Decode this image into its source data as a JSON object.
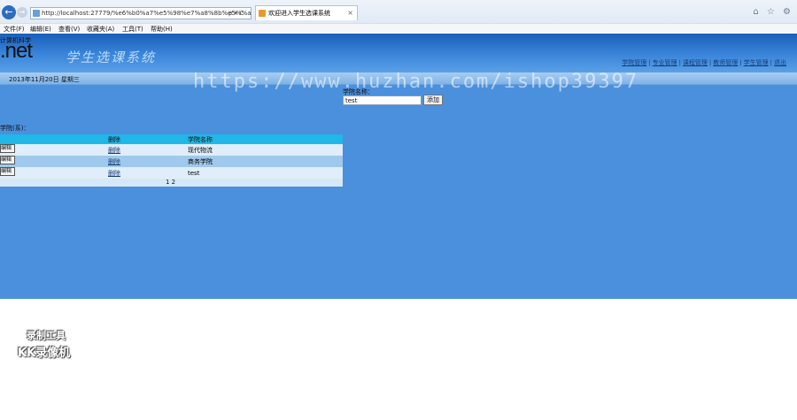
{
  "browser": {
    "address": "http://localhost:27779/%e6%b0%a7%e5%98%e7%a8%8b%e5%%a%8f",
    "address_tools": "ρ ▾ C",
    "tab_title": "欢迎进入学生选课系统",
    "tab_close": "×",
    "window_icons": "⌂ ☆ ⚙",
    "back_glyph": "←",
    "forward_glyph": "→",
    "menu": [
      "文件(F)",
      "编辑(E)",
      "查看(V)",
      "收藏夹(A)",
      "工具(T)",
      "帮助(H)"
    ]
  },
  "header": {
    "brand_small": "计算机科学",
    "brand": ".net",
    "system_title": "学生选课系统",
    "nav": [
      "学院管理",
      "专业管理",
      "课程管理",
      "教师管理",
      "学生管理",
      "退出"
    ]
  },
  "datebar": {
    "date": "2013年11月20日 星期三"
  },
  "add_form": {
    "label": "学院名称：",
    "value": "test",
    "button": "添加"
  },
  "section": {
    "title": "学院(系)："
  },
  "table": {
    "columns": [
      "",
      "删除",
      "学院名称"
    ],
    "rows": [
      {
        "edit": "编辑",
        "delete": "删除",
        "name": "现代物流"
      },
      {
        "edit": "编辑",
        "delete": "删除",
        "name": "商务学院"
      },
      {
        "edit": "编辑",
        "delete": "删除",
        "name": "test"
      }
    ],
    "pager": "1 2"
  },
  "watermark": "https://www.huzhan.com/ishop39397",
  "recorder": {
    "line1": "录制工具",
    "line2": "KK录像机"
  }
}
